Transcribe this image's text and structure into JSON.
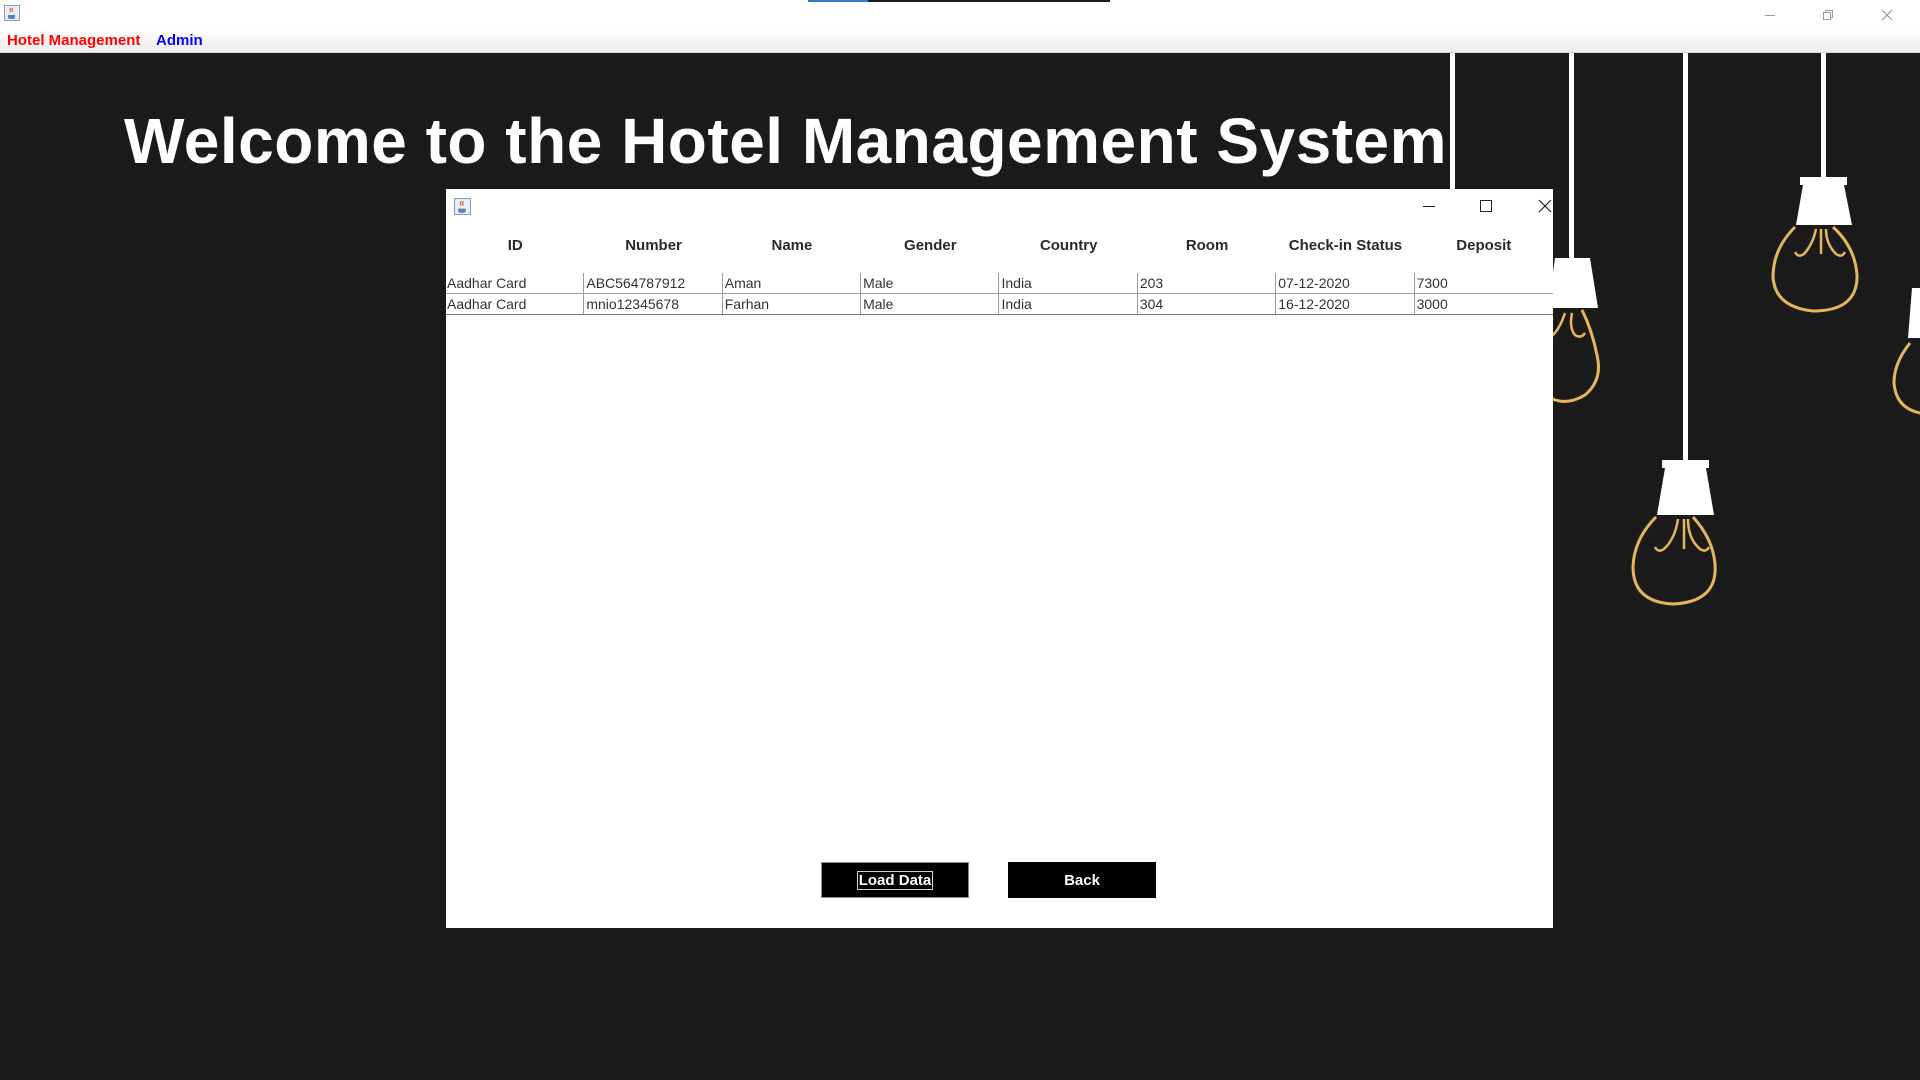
{
  "outer_window": {
    "menu": [
      {
        "label": "Hotel Management",
        "color": "#ff0000"
      },
      {
        "label": "Admin",
        "color": "#0000ff"
      }
    ]
  },
  "background": {
    "title": "Welcome to the Hotel Management System"
  },
  "dialog": {
    "table": {
      "columns": [
        "ID",
        "Number",
        "Name",
        "Gender",
        "Country",
        "Room",
        "Check-in Status",
        "Deposit"
      ],
      "rows": [
        [
          "Aadhar Card",
          "ABC564787912",
          "Aman",
          "Male",
          "India",
          "203",
          "07-12-2020",
          "7300"
        ],
        [
          "Aadhar Card",
          "mnio12345678",
          "Farhan",
          "Male",
          "India",
          "304",
          "16-12-2020",
          "3000"
        ]
      ]
    },
    "buttons": {
      "load_label": "Load Data",
      "back_label": "Back"
    }
  },
  "icons": {
    "outer_app": "java-coffee-icon",
    "dialog_app": "java-coffee-icon",
    "minimize": "minimize-icon",
    "maximize": "maximize-icon",
    "restore": "restore-icon",
    "close": "close-icon",
    "lamp": "lightbulb-icon"
  },
  "colors": {
    "background": "#1b1b1b",
    "title_text": "#ffffff",
    "button_bg": "#000000",
    "button_text": "#ffffff",
    "lamp_filament": "#e6b75a"
  }
}
